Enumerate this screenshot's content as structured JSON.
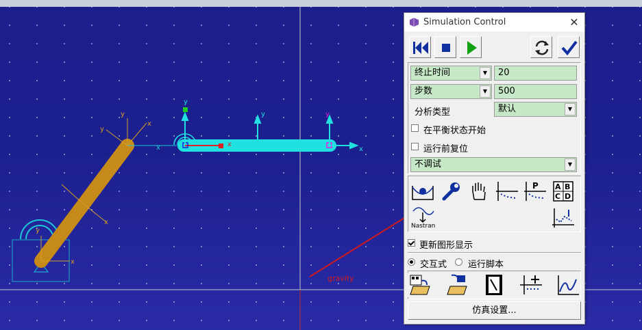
{
  "scene": {
    "gravity_label": "gravity",
    "axis_x": "x",
    "axis_y": "y"
  },
  "dialog": {
    "title": "Simulation Control",
    "toolbar": {
      "rewind": "rewind-icon",
      "stop": "stop-icon",
      "play": "play-icon",
      "reset": "refresh-icon",
      "accept": "checkmark-icon"
    },
    "end_type": {
      "selected": "终止时间",
      "value": "20"
    },
    "step_type": {
      "selected": "步数",
      "value": "500"
    },
    "analysis_type": {
      "label": "分析类型",
      "selected": "默认"
    },
    "start_at_equilibrium": {
      "label": "在平衡状态开始",
      "checked": false
    },
    "reset_before_run": {
      "label": "运行前复位",
      "checked": false
    },
    "debug": {
      "selected": "不调试"
    },
    "icon_buttons_row1": [
      "equilibrium-icon",
      "wrench-icon",
      "hand-icon",
      "plot-icon",
      "plot-p-icon",
      "abcd-table-icon"
    ],
    "nastran_label": "Nastran",
    "update_graphics": {
      "label": "更新图形显示",
      "checked": true
    },
    "mode": {
      "interactive": "交互式",
      "script": "运行脚本",
      "selected": "interactive"
    },
    "icon_buttons_row3": [
      "open-folder-icon",
      "open-file-icon",
      "film-icon",
      "table-plus-icon",
      "chart-icon"
    ],
    "sim_setup_button": "仿真设置..."
  }
}
